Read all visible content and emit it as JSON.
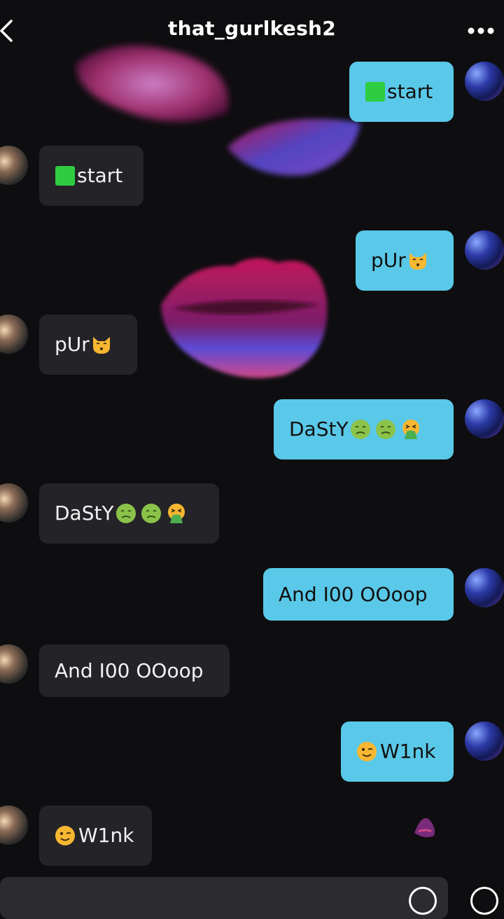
{
  "header": {
    "title": "that_gurlkesh2",
    "back_icon": "chevron-left-icon",
    "more_icon": "more-horizontal-icon"
  },
  "messages": [
    {
      "side": "mine",
      "text": "start",
      "emoji_before": "green-square-emoji"
    },
    {
      "side": "theirs",
      "text": "start",
      "emoji_before": "green-square-emoji"
    },
    {
      "side": "mine",
      "text": "pUr",
      "emoji_after": [
        "kissing-cat-emoji"
      ]
    },
    {
      "side": "theirs",
      "text": "pUr",
      "emoji_after": [
        "kissing-cat-emoji"
      ]
    },
    {
      "side": "mine",
      "text": "DaStY",
      "emoji_after": [
        "nauseated-face-emoji",
        "nauseated-face-emoji",
        "vomiting-face-emoji"
      ]
    },
    {
      "side": "theirs",
      "text": "DaStY",
      "emoji_after": [
        "nauseated-face-emoji",
        "nauseated-face-emoji",
        "vomiting-face-emoji"
      ]
    },
    {
      "side": "mine",
      "text": "And I00 OOoop"
    },
    {
      "side": "theirs",
      "text": "And I00 OOoop"
    },
    {
      "side": "mine",
      "text": "W1nk",
      "emoji_before": "winking-face-emoji"
    },
    {
      "side": "theirs",
      "text": "W1nk",
      "emoji_before": "winking-face-emoji"
    }
  ],
  "colors": {
    "background": "#0e0e10",
    "mine_bubble": "#5ac8e8",
    "theirs_bubble": "#242428",
    "lips": "#c2185b"
  },
  "composer": {
    "present": true
  }
}
